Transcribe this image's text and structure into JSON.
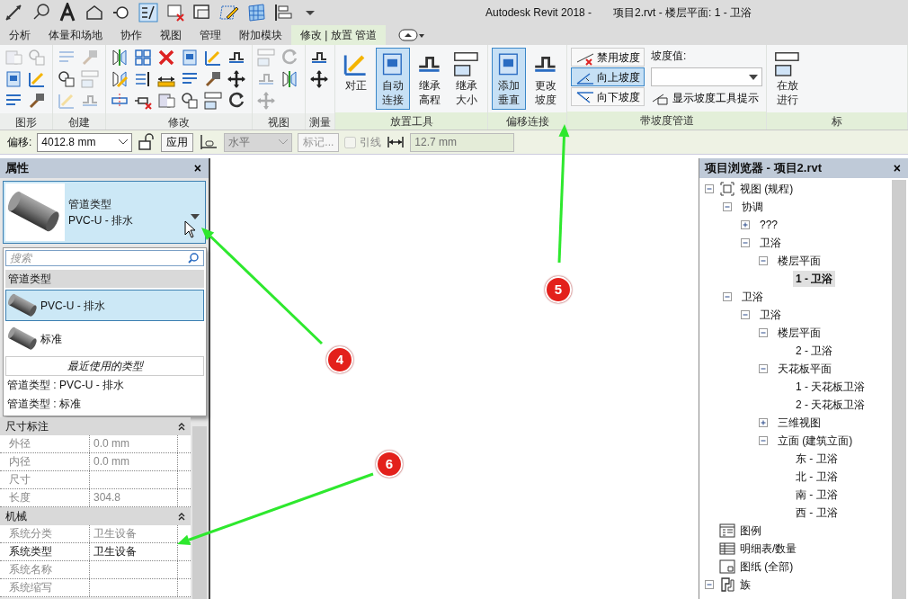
{
  "window": {
    "app": "Autodesk Revit 2018 -",
    "document": "项目2.rvt - 楼层平面: 1 - 卫浴"
  },
  "ribbon_tabs": [
    {
      "label": "分析",
      "selected": false
    },
    {
      "label": "体量和场地",
      "selected": false
    },
    {
      "label": "协作",
      "selected": false
    },
    {
      "label": "视图",
      "selected": false
    },
    {
      "label": "管理",
      "selected": false
    },
    {
      "label": "附加模块",
      "selected": false
    },
    {
      "label": "修改 | 放置 管道",
      "selected": true
    }
  ],
  "ribbon_panels": [
    {
      "label": "图形",
      "kind": "icons",
      "tools": [
        {
          "disabled": true
        },
        {
          "disabled": false
        },
        {
          "disabled": false
        },
        {
          "disabled": true
        },
        {
          "disabled": false
        },
        {
          "disabled": false
        }
      ]
    },
    {
      "label": "创建",
      "kind": "icons",
      "tools": [
        {
          "disabled": true
        },
        {
          "disabled": false
        },
        {
          "disabled": true
        },
        {
          "disabled": true
        },
        {
          "disabled": true
        },
        {
          "disabled": true
        }
      ]
    },
    {
      "label": "修改",
      "kind": "icons",
      "tools": [
        {
          "disabled": false
        },
        {
          "disabled": false
        },
        {
          "disabled": false
        },
        {
          "disabled": false
        },
        {
          "disabled": false
        },
        {
          "disabled": false
        },
        {
          "disabled": false
        },
        {
          "disabled": false
        },
        {
          "disabled": false
        },
        {
          "disabled": false
        },
        {
          "disabled": false
        },
        {
          "disabled": false
        },
        {
          "disabled": false
        },
        {
          "disabled": false
        },
        {
          "disabled": false
        },
        {
          "disabled": false
        },
        {
          "disabled": false
        },
        {
          "disabled": false
        }
      ]
    },
    {
      "label": "视图",
      "kind": "icons",
      "tools": [
        {
          "disabled": true
        },
        {
          "disabled": true
        },
        {
          "disabled": true
        },
        {
          "disabled": true
        },
        {
          "disabled": false
        }
      ]
    },
    {
      "label": "测量",
      "kind": "icons",
      "tools": [
        {
          "disabled": false
        },
        {
          "disabled": false
        }
      ]
    },
    {
      "label": "放置工具",
      "kind": "large",
      "tools": [
        {
          "label": "对正",
          "selected": false
        },
        {
          "label": "自动连接",
          "selected": true
        },
        {
          "label": "继承高程",
          "selected": false
        },
        {
          "label": "继承大小",
          "selected": false
        }
      ]
    },
    {
      "label": "偏移连接",
      "kind": "large",
      "tools": [
        {
          "label": "添加垂直",
          "selected": true
        },
        {
          "label": "更改坡度",
          "selected": false
        }
      ]
    },
    {
      "label": "带坡度管道",
      "kind": "slope",
      "buttons": [
        {
          "label": "禁用坡度",
          "selected": false
        },
        {
          "label": "向上坡度",
          "selected": true
        },
        {
          "label": "向下坡度",
          "selected": false
        }
      ],
      "value_label": "坡度值:",
      "tooltip_toggle": "显示坡度工具提示"
    },
    {
      "label": "标",
      "kind": "large",
      "tools": [
        {
          "label": "在放进行",
          "selected": false
        }
      ]
    }
  ],
  "options_bar": {
    "offset_label": "偏移:",
    "offset_value": "4012.8 mm",
    "apply": "应用",
    "justification": {
      "value": "水平",
      "disabled": true
    },
    "tag_button": {
      "label": "标记...",
      "disabled": true
    },
    "leader": {
      "label": "引线",
      "checked": false,
      "disabled": true
    },
    "leader_length": {
      "value": "12.7 mm",
      "disabled": true
    }
  },
  "properties": {
    "title": "属性",
    "close": "×",
    "type_selector": {
      "family": "管道类型",
      "type": "PVC-U - 排水"
    },
    "dropdown": {
      "search_placeholder": "搜索",
      "group": "管道类型",
      "types": [
        {
          "label": "PVC-U - 排水",
          "selected": true
        },
        {
          "label": "标准",
          "selected": false
        }
      ],
      "recent_header": "最近使用的类型",
      "recent": [
        "管道类型 : PVC-U - 排水",
        "管道类型 : 标准"
      ]
    },
    "groups": [
      {
        "label": "尺寸标注",
        "expanded": true,
        "rows": [
          {
            "name": "外径",
            "value": "0.0 mm",
            "editable": false
          },
          {
            "name": "内径",
            "value": "0.0 mm",
            "editable": false
          },
          {
            "name": "尺寸",
            "editable": false
          },
          {
            "name": "长度",
            "value": "304.8",
            "editable": false
          }
        ]
      },
      {
        "label": "机械",
        "expanded": true,
        "rows": [
          {
            "name": "系统分类",
            "value": "卫生设备",
            "editable": false
          },
          {
            "name": "系统类型",
            "value": "卫生设备",
            "editable": true
          },
          {
            "name": "系统名称",
            "editable": false
          },
          {
            "name": "系统缩写",
            "editable": false
          }
        ]
      }
    ]
  },
  "project_browser": {
    "title": "项目浏览器 - 项目2.rvt",
    "close": "×",
    "tree": [
      {
        "label": "视图 (规程)",
        "kind": "views",
        "expanded": true,
        "selected": false,
        "children": [
          {
            "label": "协调",
            "expanded": true,
            "selected": false,
            "children": [
              {
                "label": "???",
                "expanded": false,
                "selected": false
              },
              {
                "label": "卫浴",
                "expanded": true,
                "selected": false,
                "children": [
                  {
                    "label": "楼层平面",
                    "expanded": true,
                    "selected": false,
                    "children": [
                      {
                        "label": "1 - 卫浴",
                        "selected": true
                      }
                    ]
                  }
                ]
              }
            ]
          },
          {
            "label": "卫浴",
            "expanded": true,
            "selected": false,
            "children": [
              {
                "label": "卫浴",
                "expanded": true,
                "selected": false,
                "children": [
                  {
                    "label": "楼层平面",
                    "expanded": true,
                    "selected": false,
                    "children": [
                      {
                        "label": "2 - 卫浴",
                        "selected": false
                      }
                    ]
                  },
                  {
                    "label": "天花板平面",
                    "expanded": true,
                    "selected": false,
                    "children": [
                      {
                        "label": "1 - 天花板卫浴",
                        "selected": false
                      },
                      {
                        "label": "2 - 天花板卫浴",
                        "selected": false
                      }
                    ]
                  },
                  {
                    "label": "三维视图",
                    "expanded": false,
                    "selected": false
                  },
                  {
                    "label": "立面 (建筑立面)",
                    "expanded": true,
                    "selected": false,
                    "children": [
                      {
                        "label": "东 - 卫浴",
                        "selected": false
                      },
                      {
                        "label": "北 - 卫浴",
                        "selected": false
                      },
                      {
                        "label": "南 - 卫浴",
                        "selected": false
                      },
                      {
                        "label": "西 - 卫浴",
                        "selected": false
                      }
                    ]
                  }
                ]
              }
            ]
          }
        ]
      },
      {
        "label": "图例",
        "kind": "legends",
        "selected": false
      },
      {
        "label": "明细表/数量",
        "kind": "schedules",
        "selected": false
      },
      {
        "label": "图纸 (全部)",
        "kind": "sheets",
        "selected": false
      },
      {
        "label": "族",
        "kind": "families",
        "expanded": true,
        "selected": false
      }
    ]
  },
  "annotations": [
    {
      "label": "4"
    },
    {
      "label": "5"
    },
    {
      "label": "6"
    }
  ]
}
